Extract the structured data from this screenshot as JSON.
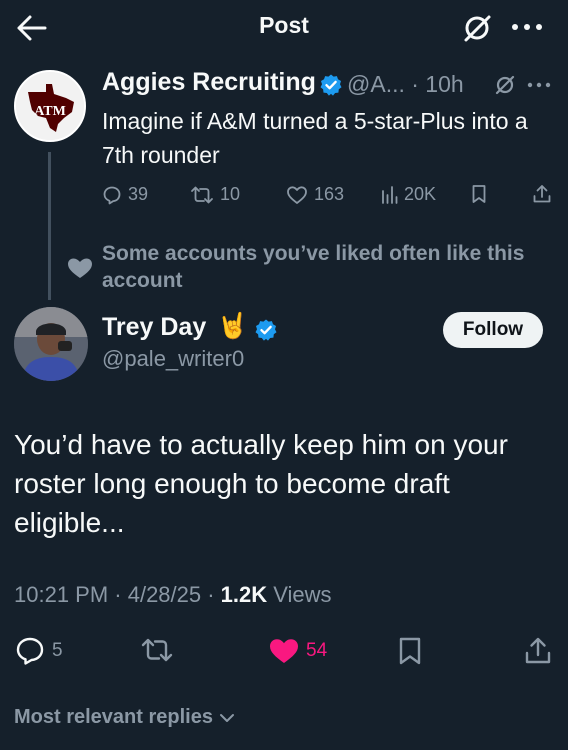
{
  "header": {
    "title": "Post"
  },
  "parent_post": {
    "author_name": "Aggies Recruiting",
    "handle_time": "@A... · 10h",
    "text": "Imagine if A&M turned a 5-star-Plus into a 7th rounder",
    "logo_text": "ATM",
    "stats": {
      "replies": "39",
      "reposts": "10",
      "likes": "163",
      "views": "20K"
    }
  },
  "social_context": "Some accounts you’ve liked often like this account",
  "reply": {
    "author_name": "Trey Day",
    "emoji": "🤘",
    "handle": "@pale_writer0",
    "follow_label": "Follow",
    "text": "You’d have to actually keep him on your roster long enough to become draft eligible...",
    "time": "10:21 PM · 4/28/25 · ",
    "views_count": "1.2K",
    "views_label": " Views",
    "actions": {
      "replies": "5",
      "likes": "54"
    }
  },
  "replies_sort": {
    "label": "Most relevant replies"
  },
  "colors": {
    "background": "#15202b",
    "verified": "#1d9bf0",
    "liked": "#f91880",
    "muted": "#8b98a5",
    "maroon": "#500000"
  }
}
